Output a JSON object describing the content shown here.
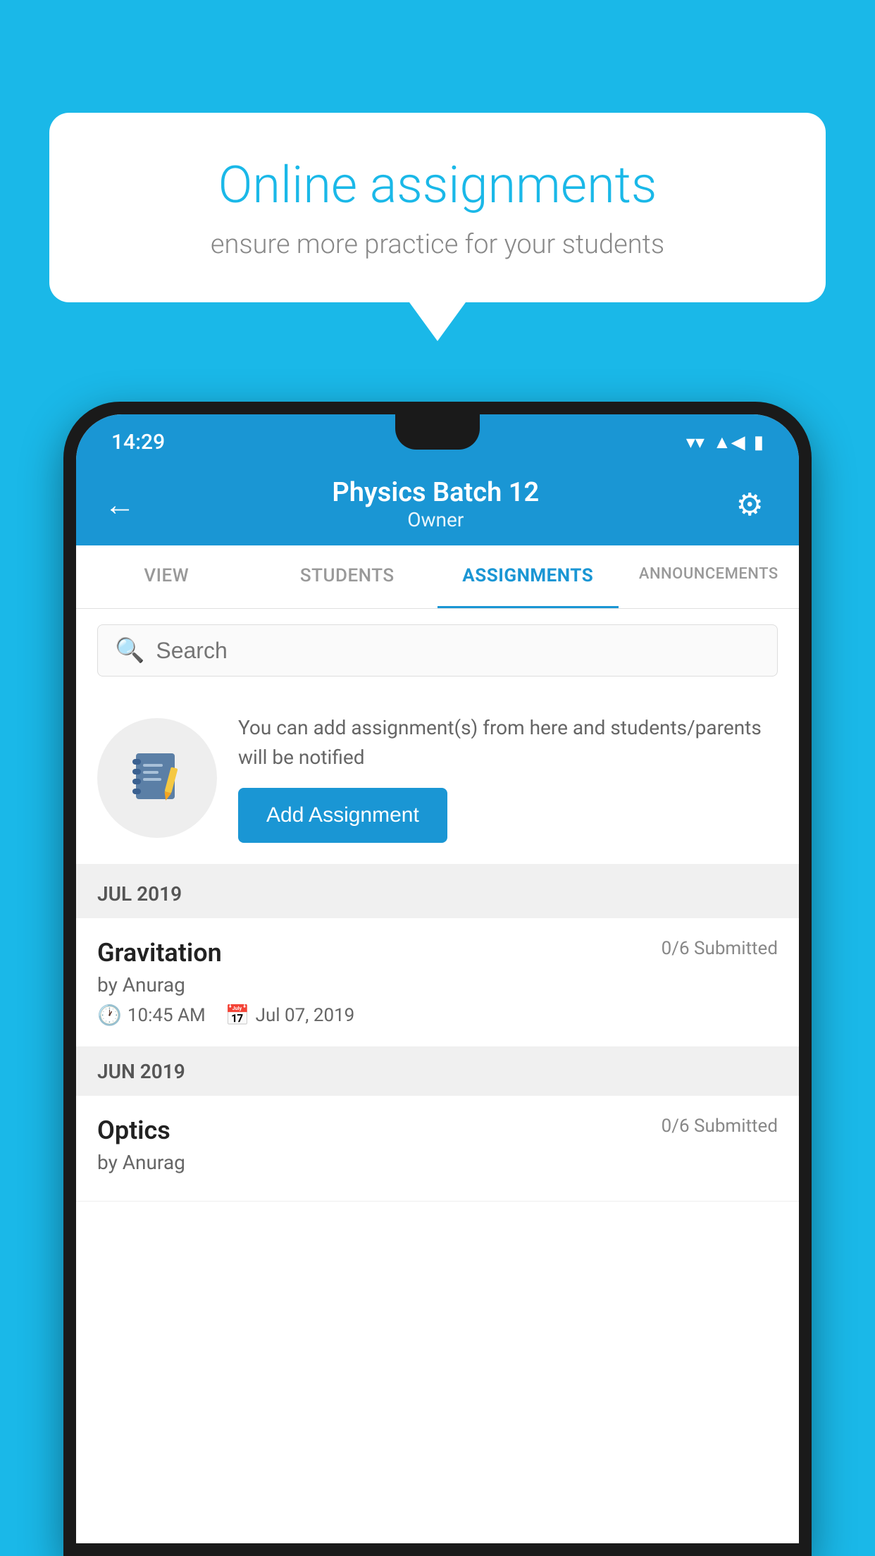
{
  "background_color": "#1ab8e8",
  "speech_bubble": {
    "title": "Online assignments",
    "subtitle": "ensure more practice for your students"
  },
  "status_bar": {
    "time": "14:29",
    "wifi_icon": "▾",
    "signal_icon": "▲",
    "battery_icon": "▮"
  },
  "header": {
    "back_label": "←",
    "title": "Physics Batch 12",
    "subtitle": "Owner",
    "settings_label": "⚙"
  },
  "tabs": [
    {
      "id": "view",
      "label": "VIEW"
    },
    {
      "id": "students",
      "label": "STUDENTS"
    },
    {
      "id": "assignments",
      "label": "ASSIGNMENTS",
      "active": true
    },
    {
      "id": "announcements",
      "label": "ANNOUNCEMENTS"
    }
  ],
  "search": {
    "placeholder": "Search"
  },
  "promo": {
    "text": "You can add assignment(s) from here and students/parents will be notified",
    "button_label": "Add Assignment",
    "icon": "📓"
  },
  "sections": [
    {
      "label": "JUL 2019",
      "assignments": [
        {
          "name": "Gravitation",
          "submitted": "0/6 Submitted",
          "author": "by Anurag",
          "time": "10:45 AM",
          "date": "Jul 07, 2019"
        }
      ]
    },
    {
      "label": "JUN 2019",
      "assignments": [
        {
          "name": "Optics",
          "submitted": "0/6 Submitted",
          "author": "by Anurag",
          "time": "",
          "date": ""
        }
      ]
    }
  ]
}
